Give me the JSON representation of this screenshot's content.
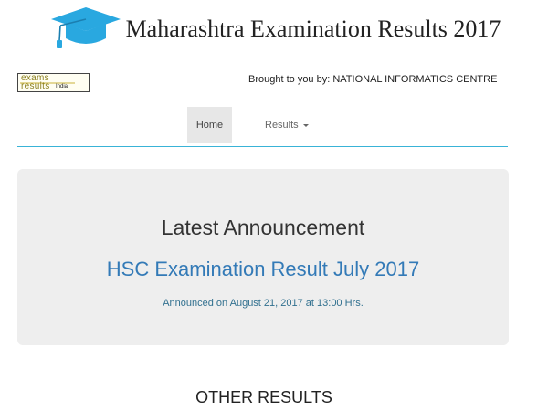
{
  "header": {
    "site_title": "Maharashtra Examination Results 2017",
    "icon": "graduation-cap-icon"
  },
  "logo": {
    "line1": "exams",
    "line2": "results",
    "line3": "India"
  },
  "credit": {
    "text": "Brought to you by: NATIONAL INFORMATICS CENTRE"
  },
  "nav": {
    "items": [
      {
        "label": "Home",
        "active": true
      },
      {
        "label": "Results",
        "has_dropdown": true
      }
    ],
    "accent_color": "#39b3d7"
  },
  "announcement": {
    "heading": "Latest Announcement",
    "link_text": "HSC Examination Result July 2017",
    "date_text": "Announced on August 21, 2017 at 13:00 Hrs."
  },
  "other_results": {
    "heading": "OTHER RESULTS"
  },
  "colors": {
    "cap": "#29a8e0",
    "link": "#337ab7",
    "panel": "#eeeeee"
  }
}
